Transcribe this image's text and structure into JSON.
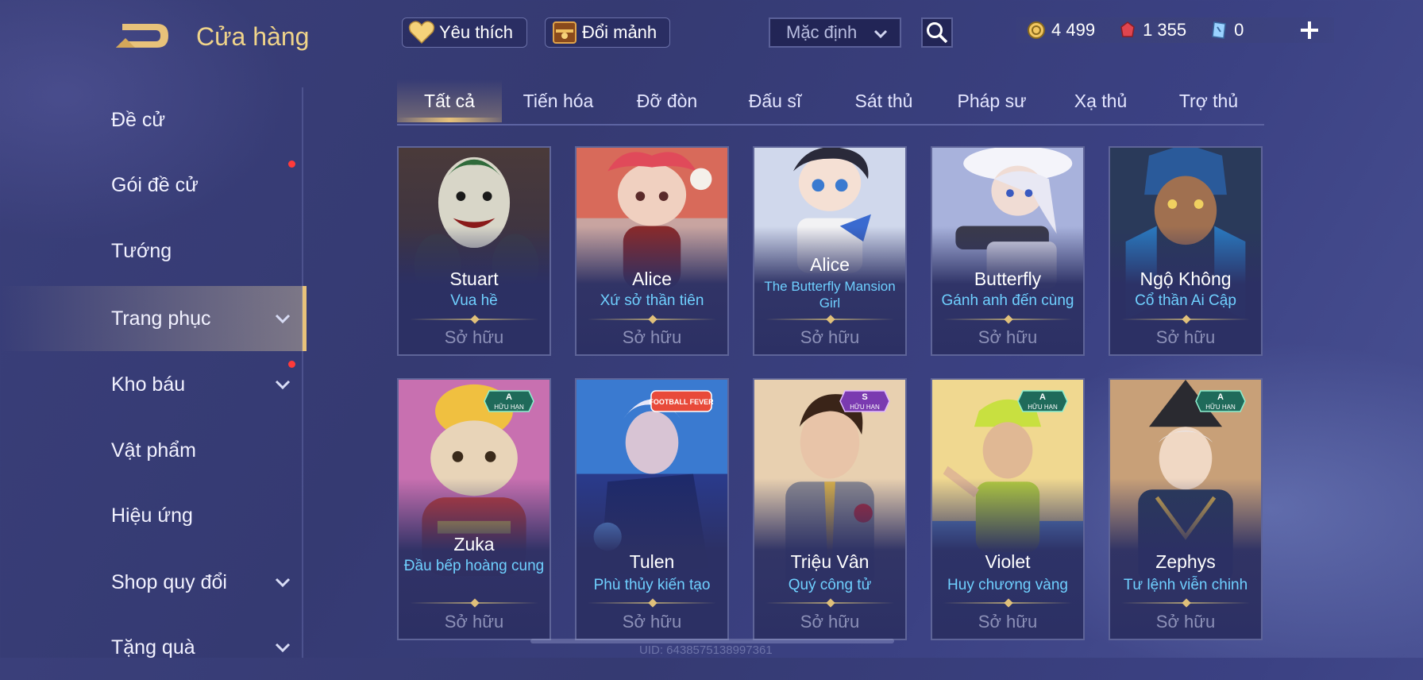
{
  "header": {
    "title": "Cửa hàng",
    "favorites_label": "Yêu thích",
    "exchange_label": "Đổi mảnh",
    "sort_value": "Mặc định"
  },
  "currency": {
    "gold": "4 499",
    "gems": "1 355",
    "tickets": "0"
  },
  "sidebar": {
    "items": [
      {
        "label": "Đề cử"
      },
      {
        "label": "Gói đề cử"
      },
      {
        "label": "Tướng"
      },
      {
        "label": "Trang phục"
      },
      {
        "label": "Kho báu"
      },
      {
        "label": "Vật phẩm"
      },
      {
        "label": "Hiệu ứng"
      },
      {
        "label": "Shop quy đổi"
      },
      {
        "label": "Tặng quà"
      }
    ]
  },
  "tabs": [
    {
      "label": "Tất cả"
    },
    {
      "label": "Tiến hóa"
    },
    {
      "label": "Đỡ đòn"
    },
    {
      "label": "Đấu sĩ"
    },
    {
      "label": "Sát thủ"
    },
    {
      "label": "Pháp sư"
    },
    {
      "label": "Xạ thủ"
    },
    {
      "label": "Trợ thủ"
    }
  ],
  "cards": [
    {
      "hero": "Stuart",
      "skin": "Vua hề",
      "status": "Sở hữu"
    },
    {
      "hero": "Alice",
      "skin": "Xứ sở thần tiên",
      "status": "Sở hữu"
    },
    {
      "hero": "Alice",
      "skin": "The Butterfly Mansion Girl",
      "status": "Sở hữu"
    },
    {
      "hero": "Butterfly",
      "skin": "Gánh anh đến cùng",
      "status": "Sở hữu"
    },
    {
      "hero": "Ngộ Không",
      "skin": "Cổ thần Ai Cập",
      "status": "Sở hữu"
    },
    {
      "hero": "Zuka",
      "skin": "Đầu bếp hoàng cung",
      "status": "Sở hữu",
      "badge_tier": "A",
      "badge_text": "HỮU HẠN"
    },
    {
      "hero": "Tulen",
      "skin": "Phù thủy kiến tạo",
      "status": "Sở hữu",
      "logo_text": "FOOTBALL FEVER"
    },
    {
      "hero": "Triệu Vân",
      "skin": "Quý công tử",
      "status": "Sở hữu",
      "badge_tier": "S",
      "badge_text": "HỮU HẠN"
    },
    {
      "hero": "Violet",
      "skin": "Huy chương vàng",
      "status": "Sở hữu",
      "badge_tier": "A",
      "badge_text": "HỮU HẠN"
    },
    {
      "hero": "Zephys",
      "skin": "Tư lệnh viễn chinh",
      "status": "Sở hữu",
      "badge_tier": "A",
      "badge_text": "HỮU HẠN"
    }
  ],
  "footer": {
    "uid": "UID: 6438575138997361"
  }
}
